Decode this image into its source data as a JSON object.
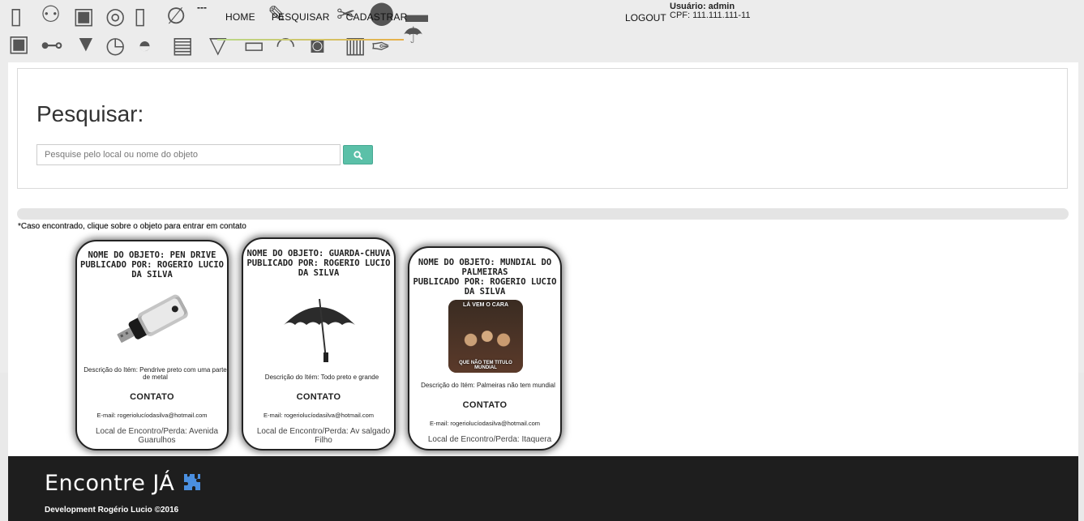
{
  "nav": {
    "dash": "---",
    "items": [
      {
        "label": "HOME"
      },
      {
        "label": "PESQUISAR"
      },
      {
        "label": "CADASTRAR"
      }
    ],
    "logout": "LOGOUT",
    "user_line": "Usuário: admin",
    "cpf_line": "CPF: 111.111.111-11"
  },
  "search": {
    "title": "Pesquisar:",
    "placeholder": "Pesquise pelo local ou nome do objeto",
    "button_icon": "search-icon"
  },
  "hint": "*Caso encontrado, clique sobre o objeto para entrar em contato",
  "items": [
    {
      "name": "NOME DO OBJETO: PEN DRIVE",
      "publisher": "PUBLICADO POR: ROGERIO LUCIO DA SILVA",
      "image": "pen-drive-image",
      "description": "Descrição do Itém: Pendrive preto com uma parte de metal",
      "contact": "CONTATO",
      "email": "E-mail: rogeriolucíodasilva@hotmail.com",
      "location": "Local de Encontro/Perda: Avenida Guarulhos"
    },
    {
      "name": "NOME DO OBJETO: GUARDA-CHUVA",
      "publisher": "PUBLICADO POR: ROGERIO LUCIO DA SILVA",
      "image": "umbrella-image",
      "description": "Descrição do Itém: Todo preto e grande",
      "contact": "CONTATO",
      "email": "E-mail: rogeriolucíodasilva@hotmail.com",
      "location": "Local de Encontro/Perda: Av salgado Filho"
    },
    {
      "name": "NOME DO OBJETO: MUNDIAL DO PALMEIRAS",
      "publisher": "PUBLICADO POR: ROGERIO LUCIO DA SILVA",
      "image": "meme-photo-image",
      "image_text_top": "LÁ VEM O CARA",
      "image_text_bottom": "QUE NÃO TEM TITULO MUNDIAL",
      "description": "Descrição do Itém: Palmeiras não tem mundial",
      "contact": "CONTATO",
      "email": "E-mail: rogeriolucíodasilva@hotmail.com",
      "location": "Local de Encontro/Perda: Itaquera"
    }
  ],
  "footer": {
    "brand": "Encontre JÁ",
    "brand_icon": "puzzle-icon",
    "copyright": "Development Rogério Lucio ©2016"
  },
  "colors": {
    "search_button": "#5bc0a8",
    "footer_bg": "#1e1e1e",
    "nav_underline_start": "#b8d98a",
    "nav_underline_end": "#e8b04a",
    "brand_icon": "#4a8fe0"
  }
}
